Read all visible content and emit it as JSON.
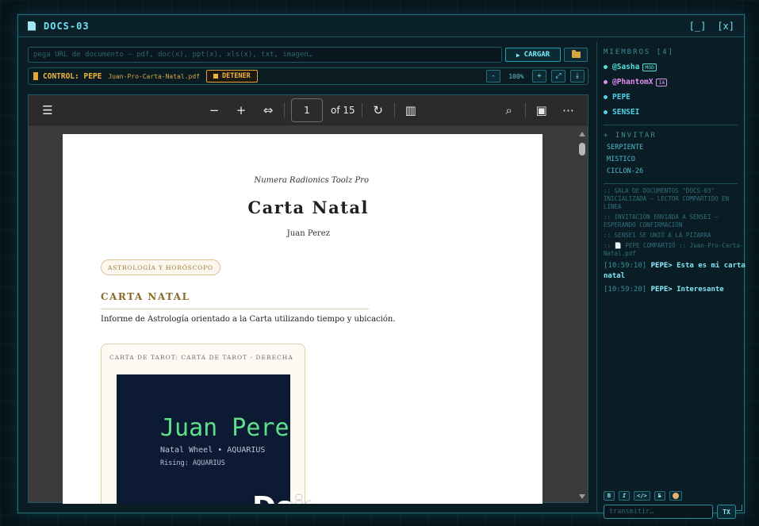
{
  "window": {
    "title": "DOCS-03",
    "minimize": "[_]",
    "close": "[x]"
  },
  "toolbar": {
    "url_placeholder": "pega URL de documento — pdf, doc(x), ppt(x), xls(x), txt, imagen…",
    "load_label": "CARGAR",
    "control_label": "CONTROL: PEPE",
    "control_file": "Juan-Pro-Carta-Natal.pdf",
    "stop_label": "DETENER",
    "zoom_out": "-",
    "zoom_level": "100%",
    "zoom_in": "+",
    "fit": "⤢",
    "download": "⤓"
  },
  "viewer": {
    "page_current": "1",
    "page_total": "of 15"
  },
  "pdf": {
    "subtitle": "Numera Radionics Toolz Pro",
    "title": "Carta Natal",
    "name": "Juan Perez",
    "badge": "ASTROLOGÍA Y HORÓSCOPO",
    "heading": "CARTA NATAL",
    "description": "Informe de Astrología orientado a la Carta utilizando tiempo y ubicación.",
    "card_label": "CARTA DE TAROT: CARTA DE TAROT - DERECHA",
    "card_name": "Juan Perez",
    "card_wheel": "Natal Wheel • AQUARIUS",
    "card_rising": "Rising: AQUARIUS",
    "watermark": "DojoFu"
  },
  "members": {
    "title": "MIEMBROS [4]",
    "list": [
      {
        "name": "@Sasha",
        "tag": "MOD",
        "color": "#4fe3d9"
      },
      {
        "name": "@PhantomX",
        "tag": "IA",
        "color": "#e08ef0"
      },
      {
        "name": "PEPE",
        "tag": "",
        "color": "#4fd0e8"
      },
      {
        "name": "SENSEI",
        "tag": "",
        "color": "#4fd0e8"
      }
    ]
  },
  "invite": {
    "title": "+ INVITAR",
    "items": [
      "SERPIENTE",
      "MISTICO",
      "CICLON-26"
    ]
  },
  "log": [
    ":: SALA DE DOCUMENTOS \"DOCS-03\" INICIALIZADA — LECTOR COMPARTIDO EN LÍNEA",
    ":: INVITACIÓN ENVIADA A SENSEI — ESPERANDO CONFIRMACIÓN",
    ":: SENSEI SE UNIÓ A LA PIZARRA",
    ":: 📄 PEPE COMPARTIÓ :: Juan-Pro-Carta-Natal.pdf"
  ],
  "chat": [
    {
      "time": "[10:59:10]",
      "user": "PEPE>",
      "msg": "Esta es mi carta natal"
    },
    {
      "time": "[10:59:20]",
      "user": "PEPE>",
      "msg": "Interesante"
    }
  ],
  "composer": {
    "bold": "B",
    "italic": "I",
    "code": "</>",
    "strike": "S",
    "placeholder": "transmitir…",
    "send": "TX"
  }
}
